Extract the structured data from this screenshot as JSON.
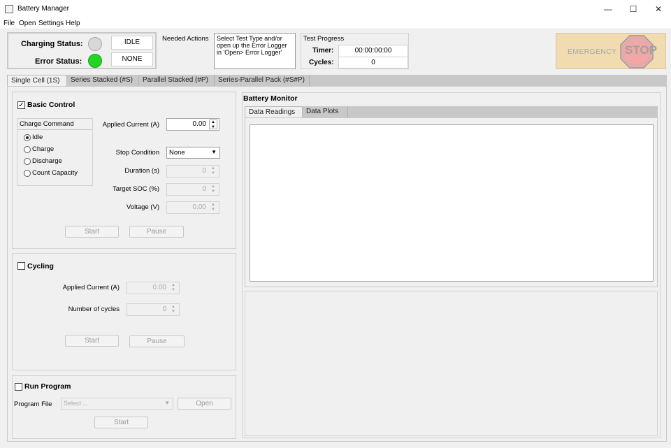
{
  "window": {
    "title": "Battery Manager",
    "minimize": "—",
    "maximize": "☐",
    "close": "✕"
  },
  "menu": [
    "File",
    "Open",
    "Settings",
    "Help"
  ],
  "status": {
    "charging_label": "Charging Status:",
    "charging_value": "IDLE",
    "error_label": "Error Status:",
    "error_value": "NONE",
    "charging_lamp_color": "#d8d8d8",
    "error_lamp_color": "#22d622"
  },
  "needed_actions": {
    "label": "Needed Actions",
    "text": "Select Test Type and/or open up the Error Logger in 'Open> Error Logger'"
  },
  "test_progress": {
    "label": "Test Progress",
    "timer_label": "Timer:",
    "timer_value": "00:00:00:00",
    "cycles_label": "Cycles:",
    "cycles_value": "0"
  },
  "emergency": {
    "label": "EMERGENCY",
    "stop": "STOP",
    "bg": "#f0dcb0",
    "stop_color": "#f2a6a6"
  },
  "tabs": [
    "Single Cell (1S)",
    "Series Stacked (#S)",
    "Parallel Stacked (#P)",
    "Series-Parallel Pack (#S#P)"
  ],
  "basic_control": {
    "title": "Basic Control",
    "checked": "✓",
    "charge_command_title": "Charge Command",
    "options": [
      "Idle",
      "Charge",
      "Discharge",
      "Count Capacity"
    ],
    "applied_current_label": "Applied Current (A)",
    "applied_current_value": "0.00",
    "stop_condition_label": "Stop Condition",
    "stop_condition_value": "None",
    "duration_label": "Duration (s)",
    "duration_value": "0",
    "target_soc_label": "Target SOC (%)",
    "target_soc_value": "0",
    "voltage_label": "Voltage (V)",
    "voltage_value": "0.00",
    "start": "Start",
    "pause": "Pause"
  },
  "cycling": {
    "title": "Cycling",
    "applied_current_label": "Applied Current (A)",
    "applied_current_value": "0.00",
    "cycles_label": "Number of cycles",
    "cycles_value": "0",
    "start": "Start",
    "pause": "Pause"
  },
  "run_program": {
    "title": "Run Program",
    "file_label": "Program File",
    "file_placeholder": "Select ...",
    "open": "Open",
    "start": "Start"
  },
  "monitor": {
    "title": "Battery Monitor",
    "tabs": [
      "Data Readings",
      "Data Plots"
    ]
  }
}
